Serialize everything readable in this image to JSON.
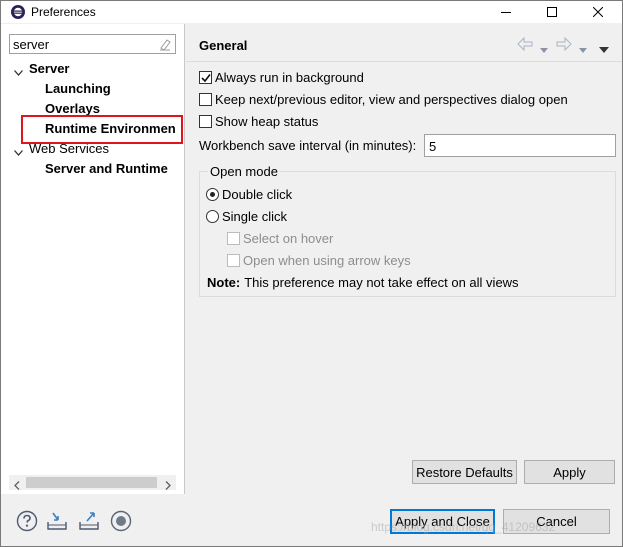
{
  "window": {
    "title": "Preferences",
    "app_icon": "eclipse-icon",
    "controls": [
      "minimize-icon",
      "maximize-icon",
      "close-icon"
    ]
  },
  "filter": {
    "value": "server",
    "clear_icon": "clear-filter-icon"
  },
  "tree": {
    "items": [
      {
        "label": "Server",
        "expanded": true,
        "bold": true
      },
      {
        "label": "Launching",
        "bold": true
      },
      {
        "label": "Overlays",
        "bold": true
      },
      {
        "label": "Runtime Environmen",
        "bold": true,
        "highlighted": true
      },
      {
        "label": "Web Services",
        "expanded": true,
        "bold": false
      },
      {
        "label": "Server and Runtime",
        "bold": true
      }
    ]
  },
  "page": {
    "title": "General",
    "nav": [
      "back-icon",
      "back-menu-icon",
      "forward-icon",
      "forward-menu-icon",
      "view-menu-icon"
    ],
    "options": [
      {
        "label": "Always run in background",
        "checked": true
      },
      {
        "label": "Keep next/previous editor, view and perspectives dialog open",
        "checked": false
      },
      {
        "label": "Show heap status",
        "checked": false
      }
    ],
    "interval_label": "Workbench save interval (in minutes):",
    "interval_value": "5",
    "open_mode": {
      "title": "Open mode",
      "double_click": "Double click",
      "single_click": "Single click",
      "selected": "Double click",
      "select_on_hover": "Select on hover",
      "open_arrow_keys": "Open when using arrow keys",
      "note_label": "Note:",
      "note_text": "This preference may not take effect on all views"
    },
    "restore_defaults": "Restore Defaults",
    "apply": "Apply"
  },
  "footer": {
    "icons": [
      "help-icon",
      "import-icon",
      "export-icon",
      "record-icon"
    ],
    "apply_close": "Apply and Close",
    "cancel": "Cancel"
  },
  "watermark": "https://blog.csdn.net/qq_41209632",
  "colors": {
    "highlight_border": "#e0141e",
    "default_button_border": "#0078d7"
  }
}
